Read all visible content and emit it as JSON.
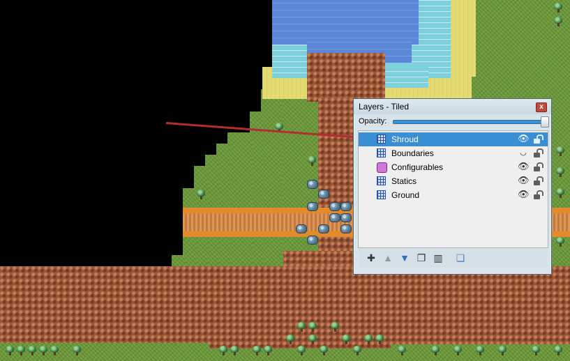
{
  "panel": {
    "title": "Layers - Tiled",
    "close_glyph": "x",
    "opacity_label": "Opacity:",
    "opacity_value": 1.0,
    "layers": [
      {
        "name": "Shroud",
        "type": "tile",
        "selected": true,
        "visible": true
      },
      {
        "name": "Boundaries",
        "type": "tile",
        "selected": false,
        "visible": false
      },
      {
        "name": "Configurables",
        "type": "object",
        "selected": false,
        "visible": true
      },
      {
        "name": "Statics",
        "type": "tile",
        "selected": false,
        "visible": true
      },
      {
        "name": "Ground",
        "type": "tile",
        "selected": false,
        "visible": true
      }
    ],
    "toolbar_icons": [
      "new-layer-icon",
      "move-up-icon",
      "move-down-icon",
      "duplicate-icon",
      "delete-icon",
      "show-others-icon"
    ]
  },
  "colors": {
    "selection": "#3a8ed2",
    "grass": "#6f9b3c",
    "dirt": "#9a5638",
    "sand": "#e4dc72",
    "shallow_water": "#7ed0dc",
    "deep_water": "#5a87d8",
    "road": "#d98a44",
    "void": "#000000",
    "red_line": "#b32e2e"
  }
}
